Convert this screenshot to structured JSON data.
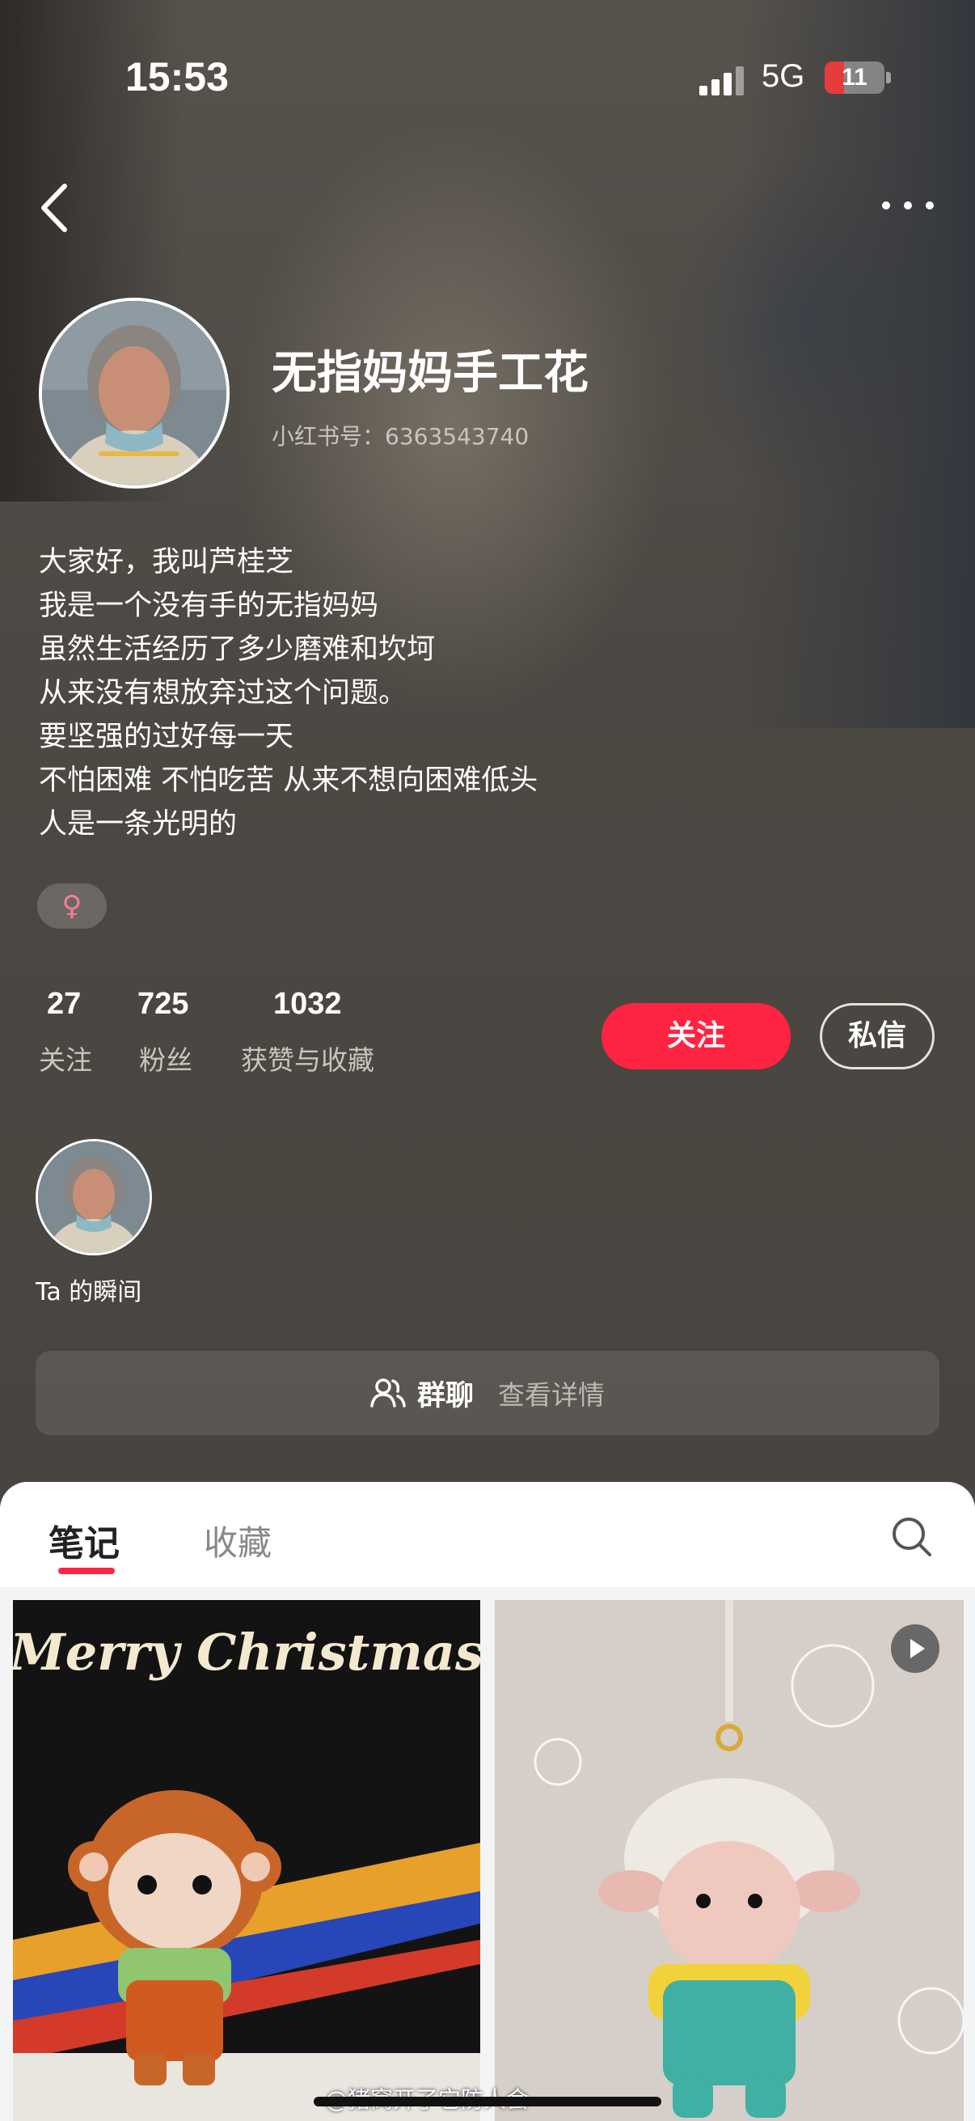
{
  "status": {
    "time": "15:53",
    "network": "5G",
    "battery": "11"
  },
  "profile": {
    "name": "无指妈妈手工花",
    "red_id": "小红书号：6363543740",
    "bio_lines": [
      "大家好，我叫芦桂芝",
      "我是一个没有手的无指妈妈",
      "虽然生活经历了多少磨难和坎坷",
      "从来没有想放弃过这个问题。",
      "要坚强的过好每一天",
      "不怕困难 不怕吃苦 从来不想向困难低头",
      "人是一条光明的"
    ],
    "gender_symbol": "♀"
  },
  "stats": [
    {
      "value": "27",
      "label": "关注"
    },
    {
      "value": "725",
      "label": "粉丝"
    },
    {
      "value": "1032",
      "label": "获赞与收藏"
    }
  ],
  "buttons": {
    "follow": "关注",
    "message": "私信"
  },
  "moment": {
    "label": "Ta 的瞬间"
  },
  "group_chat": {
    "title": "群聊",
    "detail": "查看详情"
  },
  "tabs": {
    "notes": "笔记",
    "favorites": "收藏"
  },
  "notes": [
    {
      "text_in_image": "Merry Christmas"
    },
    {
      "has_video": true
    }
  ],
  "watermark": "@猪窝开了它防人会 ",
  "colors": {
    "accent": "#ff2442",
    "background": "#4a4641",
    "sheet": "#f4f4f4"
  }
}
